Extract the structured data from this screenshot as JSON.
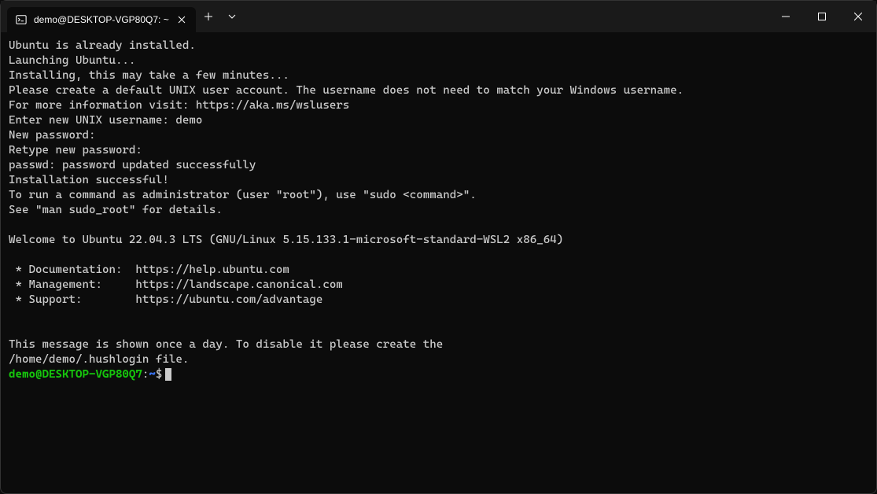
{
  "tab": {
    "title": "demo@DESKTOP-VGP80Q7: ~"
  },
  "terminal": {
    "lines": [
      "Ubuntu is already installed.",
      "Launching Ubuntu...",
      "Installing, this may take a few minutes...",
      "Please create a default UNIX user account. The username does not need to match your Windows username.",
      "For more information visit: https://aka.ms/wslusers",
      "Enter new UNIX username: demo",
      "New password:",
      "Retype new password:",
      "passwd: password updated successfully",
      "Installation successful!",
      "To run a command as administrator (user \"root\"), use \"sudo <command>\".",
      "See \"man sudo_root\" for details.",
      "",
      "Welcome to Ubuntu 22.04.3 LTS (GNU/Linux 5.15.133.1-microsoft-standard-WSL2 x86_64)",
      "",
      " * Documentation:  https://help.ubuntu.com",
      " * Management:     https://landscape.canonical.com",
      " * Support:        https://ubuntu.com/advantage",
      "",
      "",
      "This message is shown once a day. To disable it please create the",
      "/home/demo/.hushlogin file."
    ],
    "prompt": {
      "user_host": "demo@DESKTOP-VGP80Q7",
      "colon": ":",
      "path": "~",
      "dollar": "$"
    }
  }
}
